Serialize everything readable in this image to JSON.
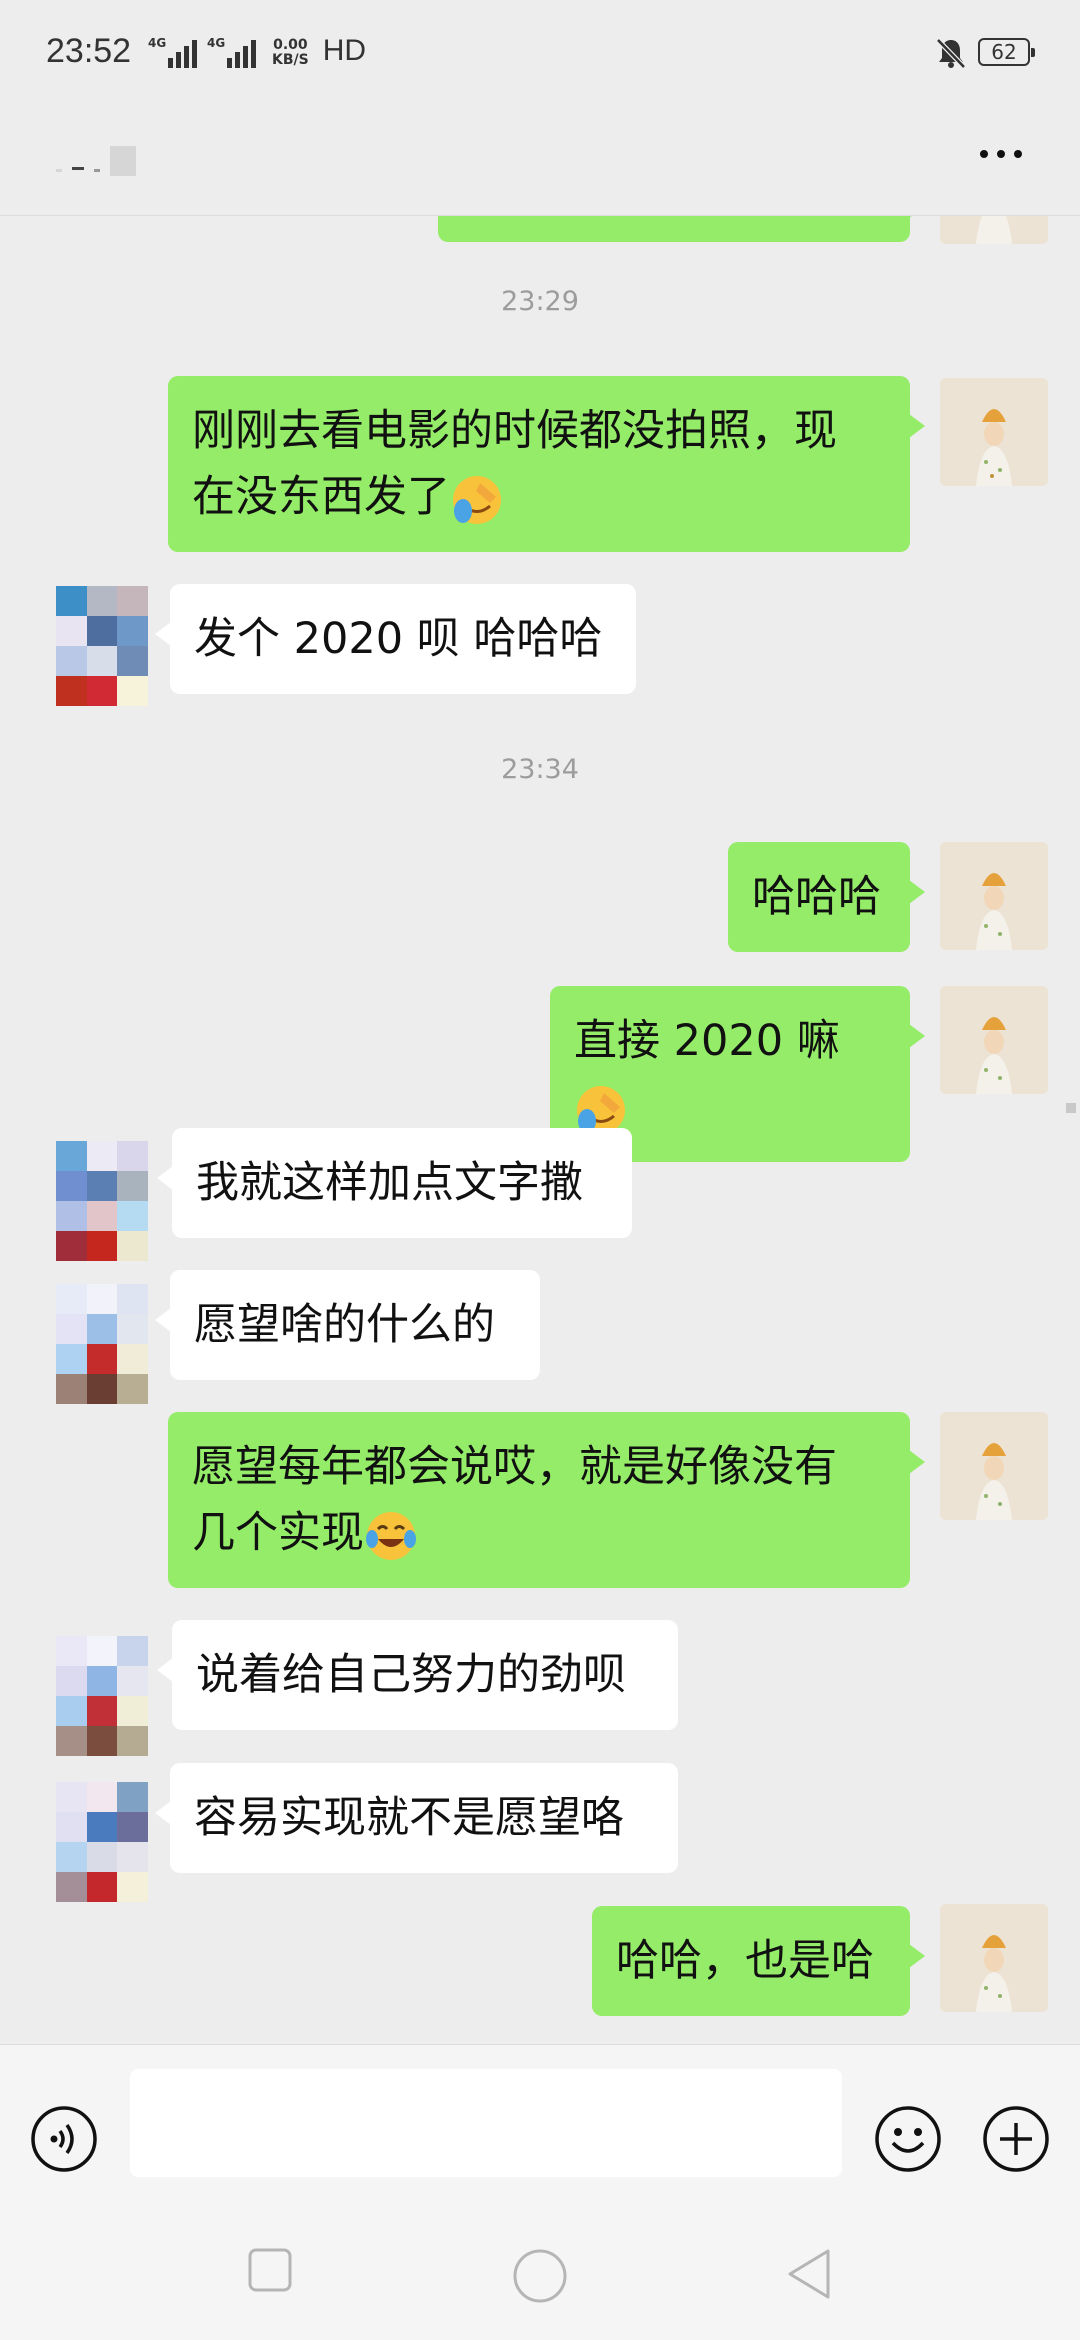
{
  "status_bar": {
    "time": "23:52",
    "sim1": "4G",
    "sim2": "4G",
    "net_speed_value": "0.00",
    "net_speed_unit": "KB/S",
    "hd_label": "HD",
    "battery": "62",
    "icons": [
      "mute-bell-icon",
      "battery-icon"
    ]
  },
  "title_bar": {
    "contact_name_obscured": true,
    "more_icon": "more-dots-icon"
  },
  "chat": {
    "timestamps": [
      "23:29",
      "23:34"
    ],
    "messages": [
      {
        "from": "me",
        "text": "刚刚去看电影的时候都没拍照，现",
        "text_line2": "在没东西发了",
        "emoji": "facepalm-emoji"
      },
      {
        "from": "peer",
        "text": "发个 2020 呗  哈哈哈"
      },
      {
        "from": "me",
        "text": "哈哈哈"
      },
      {
        "from": "me",
        "text": "直接 2020 嘛",
        "emoji": "facepalm-emoji"
      },
      {
        "from": "peer",
        "text": "我就这样加点文字撒"
      },
      {
        "from": "peer",
        "text": "愿望啥的什么的"
      },
      {
        "from": "me",
        "text": "愿望每年都会说哎，就是好像没有",
        "text_line2": "几个实现",
        "emoji": "tears-of-joy-emoji"
      },
      {
        "from": "peer",
        "text": "说着给自己努力的劲呗"
      },
      {
        "from": "peer",
        "text": "容易实现就不是愿望咯"
      },
      {
        "from": "me",
        "text": "哈哈，也是哈"
      }
    ]
  },
  "input_bar": {
    "placeholder": "",
    "icons": [
      "voice-icon",
      "emoji-icon",
      "plus-icon"
    ]
  },
  "nav_bar": {
    "icons": [
      "recents-square-icon",
      "home-circle-icon",
      "back-triangle-icon"
    ]
  },
  "colors": {
    "background": "#ededed",
    "my_bubble": "#95ec69",
    "peer_bubble": "#ffffff",
    "timestamp": "#9c9c9c"
  }
}
